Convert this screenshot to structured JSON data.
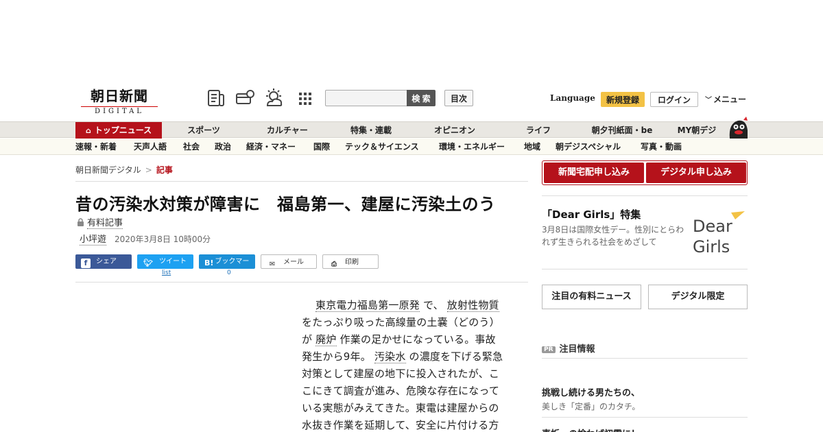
{
  "header": {
    "logo_main": "朝日新聞",
    "logo_sub": "DIGITAL",
    "search_button": "検 索",
    "toc_button": "目次",
    "language": "Language",
    "register": "新規登録",
    "login": "ログイン",
    "menu": "メニュー"
  },
  "nav_primary": [
    "トップニュース",
    "スポーツ",
    "カルチャー",
    "特集・連載",
    "オピニオン",
    "ライフ",
    "朝夕刊紙面・be",
    "MY朝デジ"
  ],
  "nav_secondary": [
    "速報・新着",
    "天声人語",
    "社会",
    "政治",
    "経済・マネー",
    "国際",
    "テック＆サイエンス",
    "環境・エネルギー",
    "地域",
    "朝デジスペシャル",
    "写真・動画"
  ],
  "breadcrumb": {
    "home": "朝日新聞デジタル",
    "sep": ">",
    "current": "記事"
  },
  "article": {
    "title": "昔の汚染水対策が障害に　福島第一、建屋に汚染土のう",
    "paid_label": "有料記事",
    "author": "小坪遊",
    "date": "2020年3月8日 10時00分",
    "body": {
      "l1a": "東京電力福島第一原発",
      "l1b": " で、 ",
      "l1c": "放射性物質",
      "l2": "をたっぷり吸った高線量の土嚢（どのう）",
      "l3a": "が ",
      "l3b": "廃炉",
      "l3c": " 作業の足かせになっている。事故",
      "l4a": "発生から9年。 ",
      "l4b": "汚染水",
      "l4c": " の濃度を下げる緊急",
      "l5": "対策として建屋の地下に投入されたが、こ",
      "l6": "こにきて調査が進み、危険な存在になって",
      "l7": "いる実態がみえてきた。東電は建屋からの",
      "l8": "水抜き作業を延期して、安全に片付ける方"
    }
  },
  "share": {
    "facebook": "シェア",
    "twitter": "ツイート",
    "twitter_count": "list",
    "hatena": "ブックマーク",
    "hatena_count": "0",
    "mail": "メール",
    "print": "印刷"
  },
  "sidebar": {
    "subscribe_paper": "新聞宅配申し込み",
    "subscribe_digital": "デジタル申し込み",
    "dear_girls_title": "「Dear Girls」特集",
    "dear_girls_desc": "3月8日は国際女性デー。性別にとらわれず生きられる社会をめざして",
    "dear_girls_logo_1": "Dear",
    "dear_girls_logo_2": "Girls",
    "btn_paid_news": "注目の有料ニュース",
    "btn_digital_only": "デジタル限定",
    "pr_badge": "PR",
    "pr_heading": "注目情報",
    "pr_item_title": "挑戦し続ける男たちの、",
    "pr_item_sub": "美しき「定番」のカタチ。",
    "pr_next": "車折・の捨わば初雷に！"
  },
  "colors": {
    "brand_red": "#b5121b",
    "register_yellow": "#f3c245",
    "twitter": "#1da1f2",
    "facebook": "#3b5998",
    "hatena": "#1b8fd6"
  }
}
